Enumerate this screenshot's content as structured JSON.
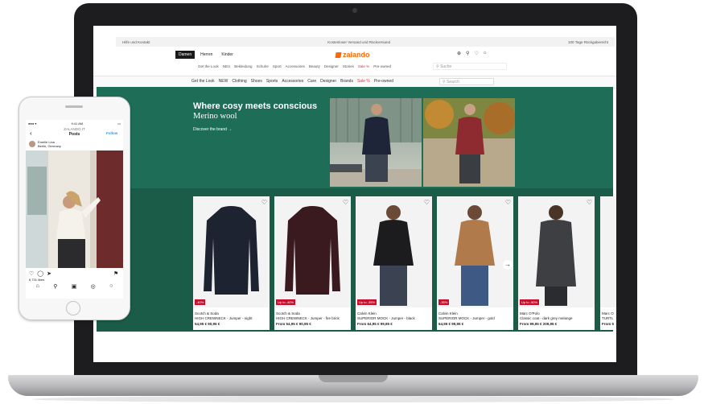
{
  "zalando": {
    "topbar": {
      "left": "Hilfe und Kontakt",
      "center": "Kostenloser Versand und Rückversand",
      "right": "100 Tage Rückgaberecht"
    },
    "tabs": [
      "Damen",
      "Herren",
      "Kinder"
    ],
    "logo": "zalando",
    "header_icons": [
      "globe-icon",
      "user-icon",
      "heart-icon",
      "bag-icon"
    ],
    "nav": [
      "Get the Look",
      "NEU",
      "Bekleidung",
      "Schuhe",
      "Sport",
      "Accessoires",
      "Beauty",
      "Designer",
      "Stories",
      "Sale %",
      "Pre-owned"
    ],
    "search_placeholder": "Suche",
    "subnav": [
      "Get the Look",
      "NEW",
      "Clothing",
      "Shoes",
      "Sports",
      "Accessories",
      "Care",
      "Designer",
      "Brands",
      "Sale %",
      "Pre-owned"
    ],
    "subnav_search_placeholder": "Search",
    "hero": {
      "title": "Where cosy meets conscious",
      "subtitle": "Merino wool",
      "link": "Discover the brand →"
    },
    "products": [
      {
        "brand": "Scotch & Soda",
        "name": "HIGH CREWNECK - Jumper - night",
        "price": "54,95 € 90,95 €",
        "badge": "-40%",
        "color": "#1e2331"
      },
      {
        "brand": "Scotch & Soda",
        "name": "HIGH CREWNECK - Jumper - fire brick",
        "price": "From 54,95 € 90,95 €",
        "badge": "Up to -40%",
        "color": "#3a1a1e"
      },
      {
        "brand": "Calvin Klein",
        "name": "SUPERIOR MOCK - Jumper - black",
        "price": "From 64,95 € 99,95 €",
        "badge": "Up to -35%",
        "color": "#1c1c1e"
      },
      {
        "brand": "Calvin Klein",
        "name": "SUPERIOR MOCK - Jumper - gold",
        "price": "64,95 € 99,95 €",
        "badge": "-35%",
        "color": "#b07a4a"
      },
      {
        "brand": "Marc O'Polo",
        "name": "Classic coat - dark grey melange",
        "price": "From 99,95 € 209,95 €",
        "badge": "Up to -50%",
        "color": "#3d3f42"
      }
    ],
    "partial_card": {
      "brand": "Marc O",
      "name": "TURTL",
      "price": "From 5"
    },
    "next_arrow": "→"
  },
  "instagram": {
    "status": {
      "left": "●●● ▾",
      "time": "9:41 AM",
      "right": "▭"
    },
    "header_small": "ZALANDO.IT",
    "header_title": "Posts",
    "follow": "Follow",
    "username": "Emelie Lina",
    "location": "Berlin, Germany",
    "likes": "6,731 likes",
    "action_icons": [
      "heart-icon",
      "comment-icon",
      "share-icon"
    ],
    "bottom_icons": [
      "home-icon",
      "search-icon",
      "reels-icon",
      "shop-icon",
      "profile-icon"
    ]
  },
  "colors": {
    "hero_green": "#1e6e57",
    "product_green": "#1b5c48",
    "brand_orange": "#ff6900",
    "sale_red": "#d9363e"
  }
}
